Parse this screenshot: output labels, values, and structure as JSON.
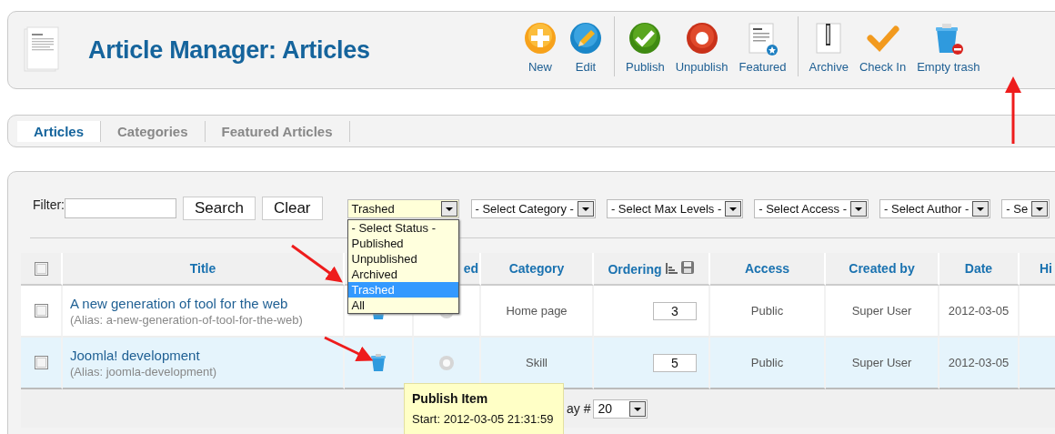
{
  "header": {
    "title": "Article Manager: Articles"
  },
  "toolbar": [
    {
      "kind": "new",
      "label": "New"
    },
    {
      "kind": "edit",
      "label": "Edit"
    },
    {
      "kind": "separator"
    },
    {
      "kind": "publish",
      "label": "Publish"
    },
    {
      "kind": "unpublish",
      "label": "Unpublish"
    },
    {
      "kind": "featured",
      "label": "Featured"
    },
    {
      "kind": "separator"
    },
    {
      "kind": "archive",
      "label": "Archive"
    },
    {
      "kind": "checkin",
      "label": "Check In"
    },
    {
      "kind": "trash",
      "label": "Empty trash"
    }
  ],
  "tabs": [
    {
      "label": "Articles",
      "selected": true
    },
    {
      "label": "Categories",
      "selected": false
    },
    {
      "label": "Featured Articles",
      "selected": false
    }
  ],
  "filter": {
    "label": "Filter:",
    "search_button": "Search",
    "clear_button": "Clear"
  },
  "selects": [
    {
      "kind": "status",
      "value": "Trashed",
      "open": true
    },
    {
      "kind": "category",
      "value": "- Select Category -",
      "open": false
    },
    {
      "kind": "levels",
      "value": "- Select Max Levels -",
      "open": false
    },
    {
      "kind": "access",
      "value": "- Select Access -",
      "open": false
    },
    {
      "kind": "author",
      "value": "- Select Author -",
      "open": false
    },
    {
      "kind": "language",
      "value": "- Se",
      "open": false
    }
  ],
  "status_options": [
    {
      "label": "- Select Status -",
      "selected": false
    },
    {
      "label": "Published",
      "selected": false
    },
    {
      "label": "Unpublished",
      "selected": false
    },
    {
      "label": "Archived",
      "selected": false
    },
    {
      "label": "Trashed",
      "selected": true
    },
    {
      "label": "All",
      "selected": false
    }
  ],
  "table": {
    "header_checkbox": {
      "checked": false
    },
    "columns": [
      {
        "kind": "title",
        "label": "Title"
      },
      {
        "kind": "status"
      },
      {
        "kind": "featured",
        "label": "ed"
      },
      {
        "kind": "category",
        "label": "Category"
      },
      {
        "kind": "ordering",
        "label": "Ordering"
      },
      {
        "kind": "access",
        "label": "Access"
      },
      {
        "kind": "created_by",
        "label": "Created by"
      },
      {
        "kind": "date",
        "label": "Date"
      },
      {
        "kind": "hits",
        "label": "Hi"
      }
    ],
    "rows": [
      {
        "checked": false,
        "highlighted": false,
        "title": "A new generation of tool for the web",
        "alias": "(Alias: a-new-generation-of-tool-for-the-web)",
        "trashed": true,
        "featured": false,
        "category": "Home page",
        "ordering": "3",
        "access": "Public",
        "created_by": "Super User",
        "date": "2012-03-05"
      },
      {
        "checked": false,
        "highlighted": true,
        "title": "Joomla! development",
        "alias": "(Alias: joomla-development)",
        "trashed": true,
        "featured": false,
        "category": "Skill",
        "ordering": "5",
        "access": "Public",
        "created_by": "Super User",
        "date": "2012-03-05"
      }
    ]
  },
  "footer": {
    "display_label": "ay #",
    "display_value": "20"
  },
  "tooltip": {
    "title": "Publish Item",
    "text": "Start: 2012-03-05 21:31:59"
  }
}
